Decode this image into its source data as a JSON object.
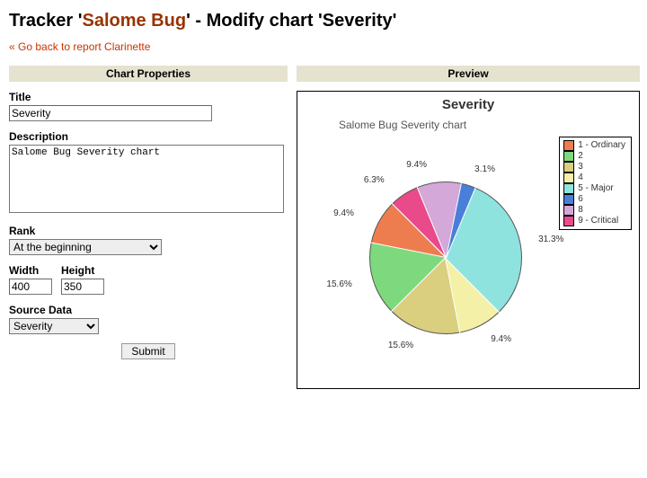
{
  "header": {
    "prefix": "Tracker '",
    "tracker": "Salome Bug",
    "suffix": "' - Modify chart 'Severity'"
  },
  "back_link": "« Go back to report Clarinette",
  "section_props": "Chart Properties",
  "section_preview": "Preview",
  "form": {
    "title_label": "Title",
    "title_value": "Severity",
    "desc_label": "Description",
    "desc_value": "Salome Bug Severity chart",
    "rank_label": "Rank",
    "rank_value": "At the beginning",
    "width_label": "Width",
    "height_label": "Height",
    "width_value": "400",
    "height_value": "350",
    "source_label": "Source Data",
    "source_value": "Severity",
    "submit": "Submit"
  },
  "chart_data": {
    "type": "pie",
    "title": "Severity",
    "subtitle": "Salome Bug Severity chart",
    "series": [
      {
        "label": "1 - Ordinary",
        "value": 9.4,
        "color": "#ed7d4f"
      },
      {
        "label": "2",
        "value": 15.6,
        "color": "#7ed97e"
      },
      {
        "label": "3",
        "value": 15.6,
        "color": "#d9cf7e"
      },
      {
        "label": "4",
        "value": 9.4,
        "color": "#f5f0a8"
      },
      {
        "label": "5 - Major",
        "value": 31.3,
        "color": "#8fe3de"
      },
      {
        "label": "6",
        "value": 3.1,
        "color": "#4a7fd9"
      },
      {
        "label": "8",
        "value": 9.4,
        "color": "#d4a8d9"
      },
      {
        "label": "9 - Critical",
        "value": 6.3,
        "color": "#e84a8a"
      }
    ],
    "start_angle_deg": -45,
    "direction": "ccw"
  }
}
